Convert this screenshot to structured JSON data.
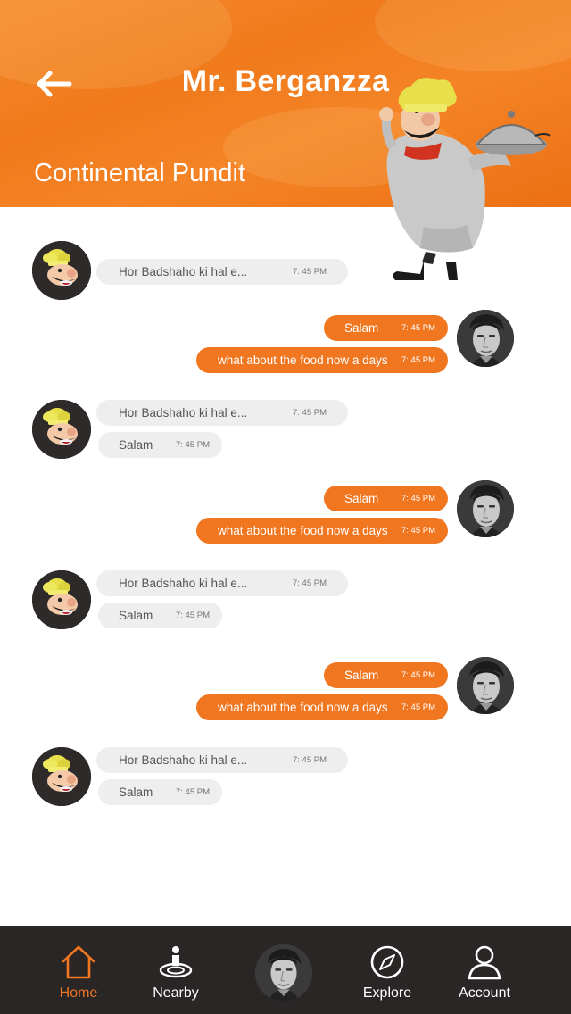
{
  "header": {
    "title": "Mr. Berganzza",
    "subtitle": "Continental Pundit",
    "back_icon": "arrow-left-icon",
    "mascot": "chef-mascot",
    "background_color": "#f07a1c"
  },
  "messages": {
    "incoming_color": "#eeeeee",
    "outgoing_color": "#f07620",
    "g1": {
      "m1": {
        "text": "Hor Badshaho ki hal e...",
        "time": "7: 45 PM"
      }
    },
    "g2": {
      "m1": {
        "text": "Salam",
        "time": "7: 45 PM"
      },
      "m2": {
        "text": "what about the food now a days",
        "time": "7: 45 PM"
      }
    },
    "g3": {
      "m1": {
        "text": "Hor Badshaho ki hal e...",
        "time": "7: 45 PM"
      },
      "m2": {
        "text": "Salam",
        "time": "7: 45 PM"
      }
    },
    "g4": {
      "m1": {
        "text": "Salam",
        "time": "7: 45 PM"
      },
      "m2": {
        "text": "what about the food now a days",
        "time": "7: 45 PM"
      }
    },
    "g5": {
      "m1": {
        "text": "Hor Badshaho ki hal e...",
        "time": "7: 45 PM"
      },
      "m2": {
        "text": "Salam",
        "time": "7: 45 PM"
      }
    },
    "g6": {
      "m1": {
        "text": "Salam",
        "time": "7: 45 PM"
      },
      "m2": {
        "text": "what about the food now a days",
        "time": "7: 45 PM"
      }
    },
    "g7": {
      "m1": {
        "text": "Hor Badshaho ki hal e...",
        "time": "7: 45 PM"
      },
      "m2": {
        "text": "Salam",
        "time": "7: 45 PM"
      }
    }
  },
  "tabbar": {
    "home": {
      "label": "Home",
      "icon": "home-icon"
    },
    "nearby": {
      "label": "Nearby",
      "icon": "location-pin-icon"
    },
    "profile": {
      "icon": "profile-avatar"
    },
    "explore": {
      "label": "Explore",
      "icon": "compass-icon"
    },
    "account": {
      "label": "Account",
      "icon": "user-icon"
    },
    "active": "Home",
    "active_color": "#f07620"
  }
}
